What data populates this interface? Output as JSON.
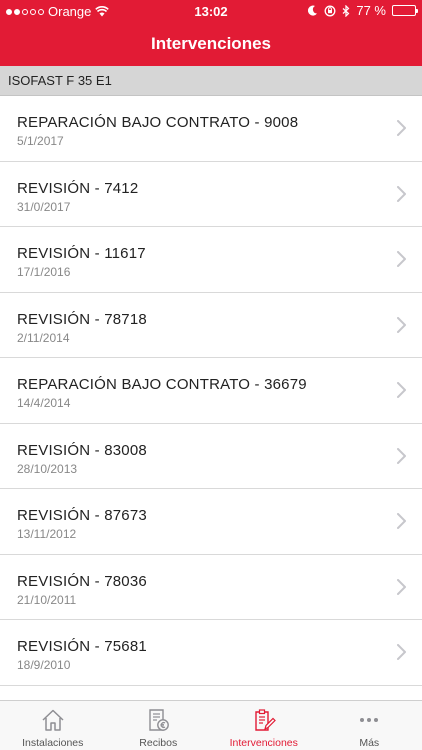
{
  "status_bar": {
    "carrier": "Orange",
    "time": "13:02",
    "battery_percent": "77 %",
    "battery_level": 0.77
  },
  "header": {
    "title": "Intervenciones",
    "color": "#e21b35"
  },
  "section": {
    "label": "ISOFAST F 35 E1"
  },
  "interventions": [
    {
      "title": "REPARACIÓN BAJO CONTRATO - 9008",
      "date": "5/1/2017"
    },
    {
      "title": "REVISIÓN - 7412",
      "date": "31/0/2017"
    },
    {
      "title": "REVISIÓN - 11617",
      "date": "17/1/2016"
    },
    {
      "title": "REVISIÓN - 78718",
      "date": "2/11/2014"
    },
    {
      "title": "REPARACIÓN BAJO CONTRATO - 36679",
      "date": "14/4/2014"
    },
    {
      "title": "REVISIÓN - 83008",
      "date": "28/10/2013"
    },
    {
      "title": "REVISIÓN - 87673",
      "date": "13/11/2012"
    },
    {
      "title": "REVISIÓN - 78036",
      "date": "21/10/2011"
    },
    {
      "title": "REVISIÓN - 75681",
      "date": "18/9/2010"
    }
  ],
  "tabbar": {
    "tabs": [
      {
        "label": "Instalaciones",
        "icon": "house-icon",
        "active": false
      },
      {
        "label": "Recibos",
        "icon": "receipt-euro-icon",
        "active": false
      },
      {
        "label": "Intervenciones",
        "icon": "clipboard-edit-icon",
        "active": true
      },
      {
        "label": "Más",
        "icon": "more-dots-icon",
        "active": false
      }
    ]
  }
}
